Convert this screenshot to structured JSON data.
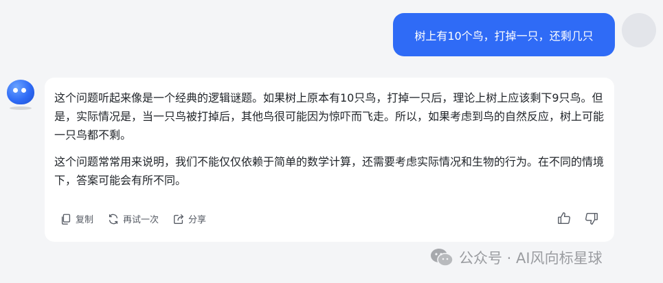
{
  "user_message": {
    "text": "树上有10个鸟，打掉一只，还剩几只"
  },
  "bot_message": {
    "paragraphs": [
      "这个问题听起来像是一个经典的逻辑谜题。如果树上原本有10只鸟，打掉一只后，理论上树上应该剩下9只鸟。但是，实际情况是，当一只鸟被打掉后，其他鸟很可能因为惊吓而飞走。所以，如果考虑到鸟的自然反应，树上可能一只鸟都不剩。",
      "这个问题常常用来说明，我们不能仅仅依赖于简单的数学计算，还需要考虑实际情况和生物的行为。在不同的情境下，答案可能会有所不同。"
    ],
    "actions": {
      "copy_label": "复制",
      "retry_label": "再试一次",
      "share_label": "分享"
    },
    "icons": {
      "copy": "copy-icon",
      "retry": "refresh-icon",
      "share": "share-icon",
      "like": "thumbs-up-icon",
      "dislike": "thumbs-down-icon"
    }
  },
  "watermark": {
    "text": "公众号 · AI风向标星球"
  },
  "colors": {
    "user_bubble": "#2f6bf6",
    "background": "#f4f5f7",
    "card": "#ffffff",
    "bot_avatar": "#2f6bf6"
  }
}
